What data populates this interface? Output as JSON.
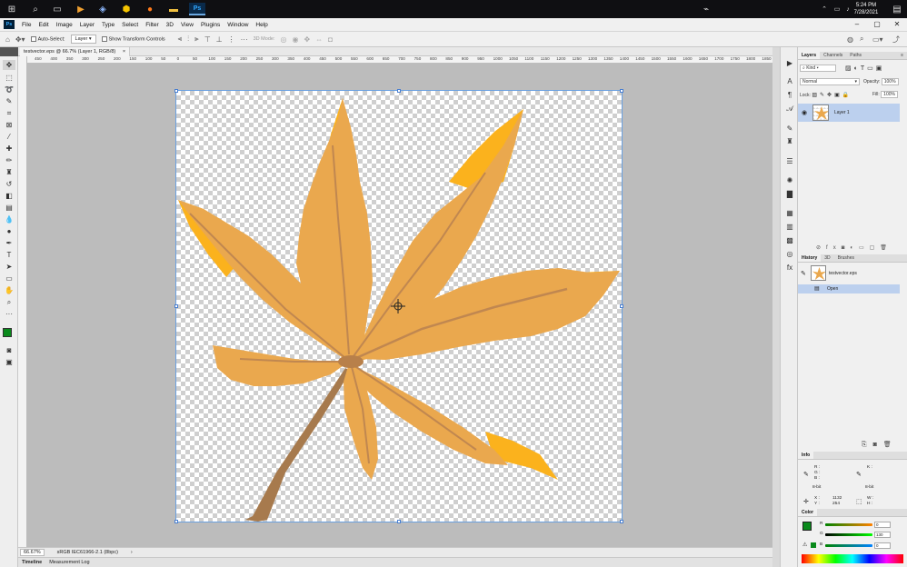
{
  "taskbar": {
    "time": "5:24 PM",
    "date": "7/28/2021"
  },
  "menu": {
    "items": [
      "File",
      "Edit",
      "Image",
      "Layer",
      "Type",
      "Select",
      "Filter",
      "3D",
      "View",
      "Plugins",
      "Window",
      "Help"
    ]
  },
  "window": {
    "minimize": "–",
    "restore": "▢",
    "close": "✕"
  },
  "options": {
    "auto_select_label": "Auto-Select:",
    "auto_select_target": "Layer",
    "transform_controls_label": "Show Transform Controls",
    "mode_3d_label": "3D Mode:"
  },
  "document": {
    "tab_label": "testvector.eps @ 66.7% (Layer 1, RGB/8)",
    "tab_close": "×"
  },
  "ruler": {
    "h_labels": [
      "450",
      "400",
      "350",
      "300",
      "250",
      "200",
      "150",
      "100",
      "50",
      "0",
      "50",
      "100",
      "150",
      "200",
      "250",
      "300",
      "350",
      "400",
      "450",
      "500",
      "550",
      "600",
      "650",
      "700",
      "750",
      "800",
      "850",
      "900",
      "950",
      "1000",
      "1050",
      "1100",
      "1150",
      "1200",
      "1250",
      "1300",
      "1350",
      "1400",
      "1450",
      "1500",
      "1550",
      "1600",
      "1650",
      "1700",
      "1750",
      "1800",
      "1850"
    ]
  },
  "status": {
    "zoom": "66.67%",
    "profile": "sRGB IEC61966-2.1 (8bpc)",
    "arrow": "›"
  },
  "bottom_tabs": [
    "Timeline",
    "Measurement Log"
  ],
  "layers_panel": {
    "tabs": [
      "Layers",
      "Channels",
      "Paths"
    ],
    "kind_label": "Kind",
    "blend_mode": "Normal",
    "opacity_label": "Opacity:",
    "opacity_value": "100%",
    "lock_label": "Lock:",
    "fill_label": "Fill:",
    "fill_value": "100%",
    "layers": [
      {
        "name": "Layer 1"
      }
    ]
  },
  "history_panel": {
    "tabs": [
      "History",
      "3D",
      "Brushes"
    ],
    "snapshot": "testvector.eps",
    "steps": [
      "Open"
    ]
  },
  "info_panel": {
    "title": "Info",
    "r": "R :",
    "g": "G :",
    "b": "B :",
    "k": "K :",
    "bit_left": "8-bit",
    "bit_right": "8-bit",
    "x_label": "X :",
    "y_label": "Y :",
    "x_value": "1132",
    "y_value": "254",
    "w_label": "W :",
    "h_label": "H :"
  },
  "color_panel": {
    "title": "Color",
    "r_label": "R",
    "g_label": "G",
    "b_label": "B",
    "r_value": "0",
    "g_value": "130",
    "b_value": "0",
    "fg": "#0a8a1c",
    "bg": "#ffffff"
  },
  "colors": {
    "leaf_light": "#eaa84e",
    "leaf_bright": "#fbb21d",
    "vein": "#c08750",
    "stem": "#a77a4d",
    "selection": "#bcd0ee"
  }
}
